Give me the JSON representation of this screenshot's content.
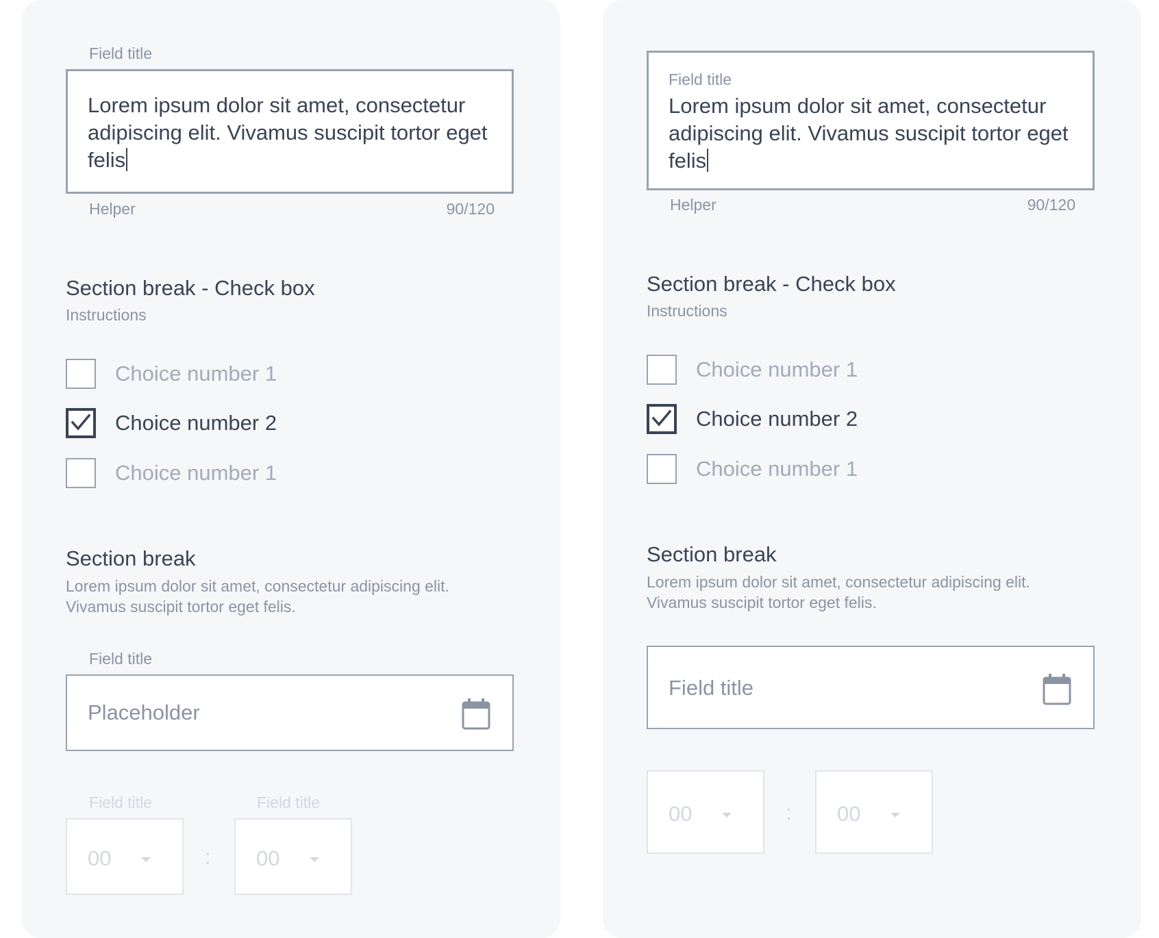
{
  "left": {
    "textarea": {
      "field_title": "Field title",
      "value": "Lorem ipsum dolor sit amet, consectetur adipiscing elit. Vivamus suscipit tortor eget felis",
      "helper": "Helper",
      "counter": "90/120"
    },
    "checkbox_section": {
      "title": "Section break - Check box",
      "instructions": "Instructions",
      "choices": [
        {
          "label": "Choice number 1",
          "checked": false
        },
        {
          "label": "Choice number 2",
          "checked": true
        },
        {
          "label": "Choice number 1",
          "checked": false
        }
      ]
    },
    "section": {
      "title": "Section break",
      "description": "Lorem ipsum dolor sit amet, consectetur adipiscing elit. Vivamus suscipit tortor eget felis."
    },
    "date": {
      "field_title": "Field title",
      "placeholder": "Placeholder"
    },
    "time": {
      "hour_title": "Field title",
      "minute_title": "Field title",
      "hour": "00",
      "minute": "00",
      "separator": ":"
    }
  },
  "right": {
    "textarea": {
      "field_title": "Field title",
      "value": "Lorem ipsum dolor sit amet, consectetur adipiscing elit. Vivamus suscipit tortor eget felis",
      "helper": "Helper",
      "counter": "90/120"
    },
    "checkbox_section": {
      "title": "Section break - Check box",
      "instructions": "Instructions",
      "choices": [
        {
          "label": "Choice number 1",
          "checked": false
        },
        {
          "label": "Choice number 2",
          "checked": true
        },
        {
          "label": "Choice number 1",
          "checked": false
        }
      ]
    },
    "section": {
      "title": "Section break",
      "description": "Lorem ipsum dolor sit amet, consectetur adipiscing elit. Vivamus suscipit tortor eget felis."
    },
    "date": {
      "placeholder": "Field title"
    },
    "time": {
      "hour": "00",
      "minute": "00",
      "separator": ":"
    }
  },
  "colors": {
    "panel_bg": "#f5f7f9",
    "text_dark": "#3a4454",
    "text_muted": "#8b94a3",
    "border": "#9aa2ae",
    "disabled": "#d3d8df"
  },
  "icons": {
    "date_picker": "calendar-icon",
    "checked_mark": "check-icon",
    "time_dropdown": "caret-down-icon"
  }
}
